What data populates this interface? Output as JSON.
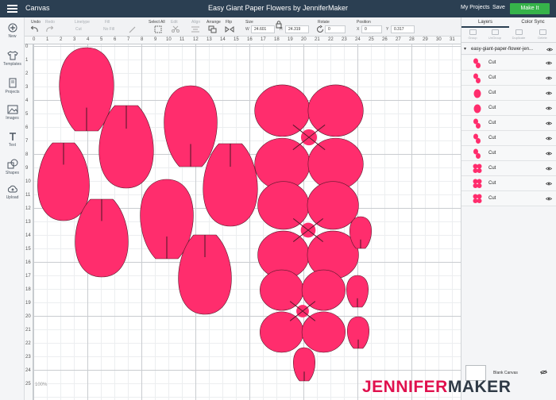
{
  "app": {
    "menu_label": "Canvas",
    "document_title": "Easy Giant Paper Flowers by JenniferMaker",
    "my_projects": "My Projects",
    "save": "Save",
    "make_it": "Make It"
  },
  "left_tools": [
    {
      "label": "New",
      "icon": "plus-icon"
    },
    {
      "label": "Templates",
      "icon": "tshirt-icon"
    },
    {
      "label": "Projects",
      "icon": "book-icon"
    },
    {
      "label": "Images",
      "icon": "image-icon"
    },
    {
      "label": "Text",
      "icon": "text-icon"
    },
    {
      "label": "Shapes",
      "icon": "shapes-icon"
    },
    {
      "label": "Upload",
      "icon": "cloud-upload-icon"
    }
  ],
  "toolbar": {
    "undo": "Undo",
    "redo": "Redo",
    "linetype": "Linetype",
    "linetype_value": "Cut",
    "fill": "Fill",
    "fill_value": "No Fill",
    "select_all": "Select All",
    "edit": "Edit",
    "align": "Align",
    "arrange": "Arrange",
    "flip": "Flip",
    "size": "Size",
    "w_label": "W",
    "w_value": "24.601",
    "h_label": "H",
    "h_value": "24.319",
    "rotate": "Rotate",
    "rotate_value": "0",
    "position": "Position",
    "x_label": "X",
    "x_value": "0",
    "y_label": "Y",
    "y_value": "0.317"
  },
  "ruler": {
    "top": [
      "0",
      "1",
      "2",
      "3",
      "4",
      "5",
      "6",
      "7",
      "8",
      "9",
      "10",
      "11",
      "12",
      "13",
      "14",
      "15",
      "16",
      "17",
      "18",
      "19",
      "20",
      "21",
      "22",
      "23",
      "24",
      "25",
      "26",
      "27",
      "28",
      "29",
      "30",
      "31"
    ],
    "left": [
      "0",
      "1",
      "2",
      "3",
      "4",
      "5",
      "6",
      "7",
      "8",
      "9",
      "10",
      "11",
      "12",
      "13",
      "14",
      "15",
      "16",
      "17",
      "18",
      "19",
      "20",
      "21",
      "22",
      "23",
      "24",
      "25"
    ]
  },
  "canvas": {
    "zoom": "100%",
    "petal_color": "#ff2d6d",
    "petal_stroke": "#5a1a2c"
  },
  "panel": {
    "tab_layers": "Layers",
    "tab_color_sync": "Color Sync",
    "actions": [
      "Group",
      "UnGroup",
      "Duplicate",
      "Delete"
    ],
    "group_name": "easy-giant-paper-flower-jen...",
    "layers": [
      {
        "name": "Cut",
        "thumb": "two-petals"
      },
      {
        "name": "Cut",
        "thumb": "two-petals"
      },
      {
        "name": "Cut",
        "thumb": "petal"
      },
      {
        "name": "Cut",
        "thumb": "petal"
      },
      {
        "name": "Cut",
        "thumb": "two-petals"
      },
      {
        "name": "Cut",
        "thumb": "two-petals"
      },
      {
        "name": "Cut",
        "thumb": "two-petals"
      },
      {
        "name": "Cut",
        "thumb": "flower"
      },
      {
        "name": "Cut",
        "thumb": "flower"
      },
      {
        "name": "Cut",
        "thumb": "flower"
      }
    ],
    "blank_canvas": "Blank Canvas"
  },
  "watermark": {
    "part1": "JENNIFER",
    "part2": "MAKER"
  }
}
